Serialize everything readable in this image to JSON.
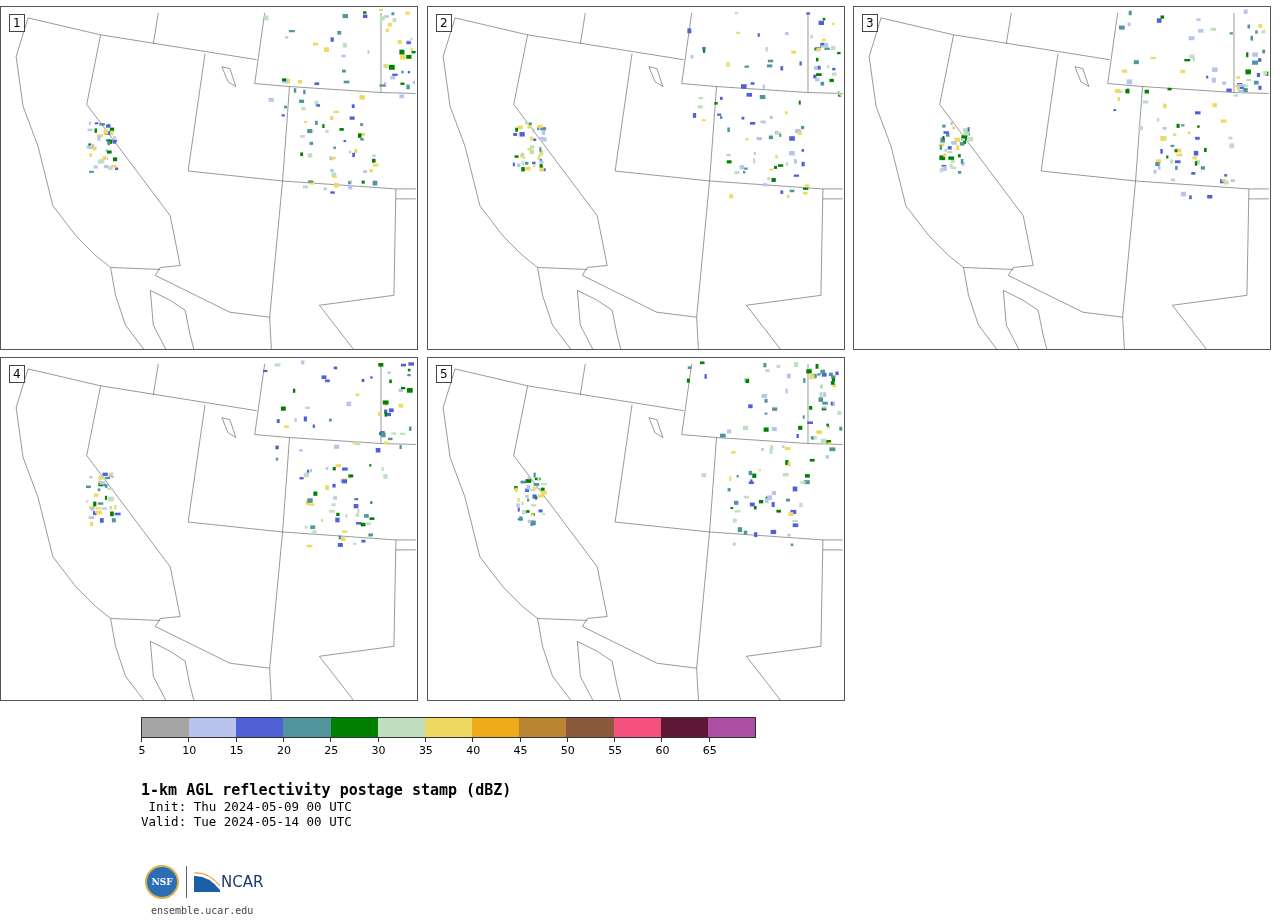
{
  "panels": [
    {
      "label": "1"
    },
    {
      "label": "2"
    },
    {
      "label": "3"
    },
    {
      "label": "4"
    },
    {
      "label": "5"
    }
  ],
  "colorbar": {
    "segments": [
      {
        "color": "#a5a5a5"
      },
      {
        "color": "#b8c3ee"
      },
      {
        "color": "#5061d6"
      },
      {
        "color": "#4f959b"
      },
      {
        "color": "#008000"
      },
      {
        "color": "#bfdfbe"
      },
      {
        "color": "#efd962"
      },
      {
        "color": "#efac1a"
      },
      {
        "color": "#bb8431"
      },
      {
        "color": "#8b5a3e"
      },
      {
        "color": "#f4517e"
      },
      {
        "color": "#611836"
      },
      {
        "color": "#ad4da4"
      }
    ],
    "ticks": [
      "5",
      "10",
      "15",
      "20",
      "25",
      "30",
      "35",
      "40",
      "45",
      "50",
      "55",
      "60",
      "65"
    ]
  },
  "title": "1-km AGL reflectivity postage stamp (dBZ)",
  "init": " Init: Thu 2024-05-09 00 UTC",
  "valid": "Valid: Tue 2024-05-14 00 UTC",
  "logo": {
    "nsf": "NSF",
    "ncar": "NCAR"
  },
  "url": "ensemble.ucar.edu"
}
